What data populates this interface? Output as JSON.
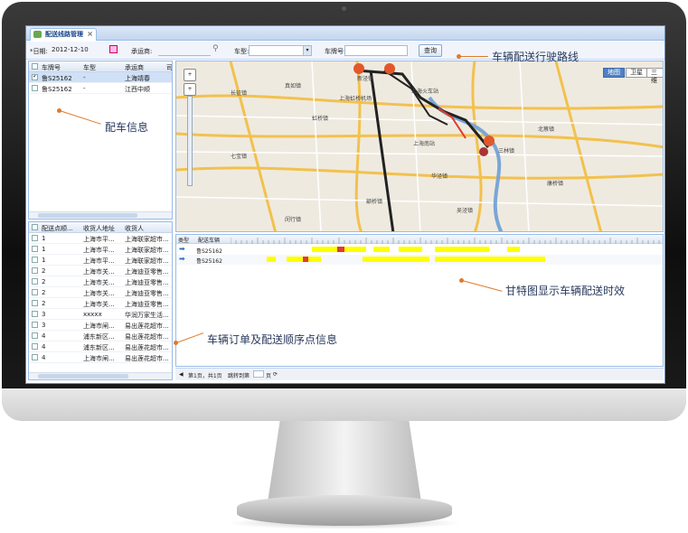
{
  "tab": {
    "title": "配送线路管理"
  },
  "toolbar": {
    "date_label": "*日期:",
    "date_value": "2012-12-10",
    "carrier_label": "承运商:",
    "type_label": "车型:",
    "plate_label": "车牌号:",
    "query_button": "查询"
  },
  "vehicle_grid": {
    "headers": [
      "车牌号",
      "车型",
      "承运商",
      "司"
    ],
    "rows": [
      {
        "plate": "鲁S25162",
        "type": "-",
        "carrier": "上海靖春",
        "checked": true
      },
      {
        "plate": "鲁S25162",
        "type": "-",
        "carrier": "江西中顺",
        "checked": false
      }
    ]
  },
  "order_grid": {
    "headers": [
      "配送点顺...",
      "收货人地址",
      "收货人"
    ],
    "rows": [
      {
        "seq": "1",
        "addr": "上海市平...",
        "name": "上海联家超市..."
      },
      {
        "seq": "1",
        "addr": "上海市平...",
        "name": "上海联家超市..."
      },
      {
        "seq": "1",
        "addr": "上海市平...",
        "name": "上海联家超市..."
      },
      {
        "seq": "2",
        "addr": "上海市关...",
        "name": "上海迪亚零售..."
      },
      {
        "seq": "2",
        "addr": "上海市关...",
        "name": "上海迪亚零售..."
      },
      {
        "seq": "2",
        "addr": "上海市关...",
        "name": "上海迪亚零售..."
      },
      {
        "seq": "2",
        "addr": "上海市关...",
        "name": "上海迪亚零售..."
      },
      {
        "seq": "3",
        "addr": "xxxxx",
        "name": "华润万家生活..."
      },
      {
        "seq": "3",
        "addr": "上海市闸...",
        "name": "易出莲花超市..."
      },
      {
        "seq": "4",
        "addr": "浦东新区...",
        "name": "易出莲花超市..."
      },
      {
        "seq": "4",
        "addr": "浦东新区...",
        "name": "易出莲花超市..."
      },
      {
        "seq": "4",
        "addr": "上海市闸...",
        "name": "易出莲花超市..."
      }
    ]
  },
  "map": {
    "types": [
      "地图",
      "卫星",
      "三维"
    ],
    "labels": [
      "真如镇",
      "新泾镇",
      "长征镇",
      "虹桥镇",
      "上海虹桥机场",
      "上海南站",
      "华泾镇",
      "颛桥镇",
      "三林镇",
      "北蔡镇",
      "上海火车站",
      "康桥镇",
      "七宝镇",
      "闵行镇",
      "吴泾镇"
    ],
    "route_markers": [
      "1",
      "2",
      "3",
      "4"
    ]
  },
  "gantt": {
    "headers": [
      "类型",
      "配送车辆"
    ],
    "rows": [
      {
        "plate": "鲁S25162"
      },
      {
        "plate": "鲁S25162"
      }
    ]
  },
  "pager": {
    "text": "第1页，共1页",
    "jump": "跳转到第",
    "page": "页"
  },
  "callouts": {
    "route": "车辆配送行驶路线",
    "vehicle": "配车信息",
    "gantt": "甘特图显示车辆配送时效",
    "orders": "车辆订单及配送顺序点信息"
  },
  "colors": {
    "accent": "#e07a2a",
    "gantt_bar": "#ffff00",
    "gantt_stop": "#e23b2a",
    "route": "#222222"
  }
}
